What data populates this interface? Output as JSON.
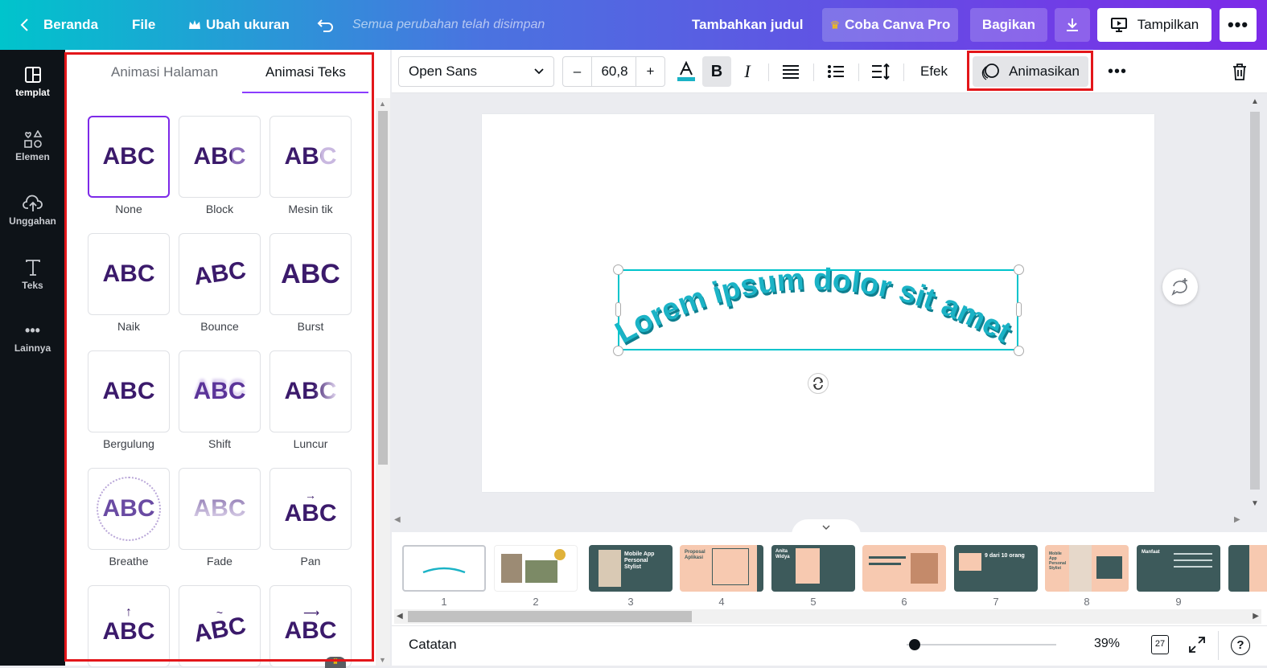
{
  "topbar": {
    "home_label": "Beranda",
    "file_label": "File",
    "resize_label": "Ubah ukuran",
    "saved_status": "Semua perubahan telah disimpan",
    "title_placeholder": "Tambahkan judul",
    "pro_label": "Coba Canva Pro",
    "share_label": "Bagikan",
    "present_label": "Tampilkan"
  },
  "siderail": {
    "items": [
      {
        "label": "templat",
        "icon": "layout-icon"
      },
      {
        "label": "Elemen",
        "icon": "shapes-icon"
      },
      {
        "label": "Unggahan",
        "icon": "cloud-upload-icon"
      },
      {
        "label": "Teks",
        "icon": "text-icon"
      },
      {
        "label": "Lainnya",
        "icon": "more-dots-icon"
      }
    ]
  },
  "panel": {
    "tabs": [
      {
        "label": "Animasi Halaman"
      },
      {
        "label": "Animasi Teks",
        "active": true
      }
    ],
    "cards": [
      {
        "sample": "ABC",
        "label": "None"
      },
      {
        "sample": "ABC",
        "label": "Block"
      },
      {
        "sample": "ABC",
        "label": "Mesin tik"
      },
      {
        "sample": "ABC",
        "label": "Naik"
      },
      {
        "sample": "ABC",
        "label": "Bounce"
      },
      {
        "sample": "ABC",
        "label": "Burst"
      },
      {
        "sample": "ABC",
        "label": "Bergulung"
      },
      {
        "sample": "ABC",
        "label": "Shift"
      },
      {
        "sample": "ABC",
        "label": "Luncur"
      },
      {
        "sample": "ABC",
        "label": "Breathe"
      },
      {
        "sample": "ABC",
        "label": "Fade"
      },
      {
        "sample": "ABC",
        "label": "Pan"
      },
      {
        "sample": "ABC",
        "label": ""
      },
      {
        "sample": "ABC",
        "label": ""
      },
      {
        "sample": "ABC",
        "label": ""
      }
    ]
  },
  "toolbar": {
    "font": "Open Sans",
    "minus": "–",
    "font_size": "60,8",
    "plus": "+",
    "effects_label": "Efek",
    "animate_label": "Animasikan"
  },
  "canvas": {
    "text": "Lorem ipsum dolor sit amet,",
    "text_color": "#1bb3c6"
  },
  "filmstrip": {
    "pages": [
      {
        "num": "1",
        "bg": "#ffffff"
      },
      {
        "num": "2",
        "bg": "#ffffff"
      },
      {
        "num": "3",
        "bg": "#3d5a5b",
        "text": "Mobile App Personal Stylist"
      },
      {
        "num": "4",
        "bg": "#f7c9b0",
        "text": "Proposal Aplikasi"
      },
      {
        "num": "5",
        "bg": "#3d5a5b",
        "text": "Anita Widya"
      },
      {
        "num": "6",
        "bg": "#f7c9b0",
        "text": ""
      },
      {
        "num": "7",
        "bg": "#3d5a5b",
        "text": "9 dari 10 orang"
      },
      {
        "num": "8",
        "bg": "#f7c9b0",
        "text": "Mobile App Personal Stylist"
      },
      {
        "num": "9",
        "bg": "#3d5a5b",
        "text": "Manfaat"
      }
    ]
  },
  "footer": {
    "notes_label": "Catatan",
    "zoom": "39%",
    "page_count": "27"
  },
  "colors": {
    "accent": "#7d2ae8",
    "highlight": "#e3161a",
    "selection": "#00c4cc",
    "abc_text": "#3b1a6b"
  }
}
